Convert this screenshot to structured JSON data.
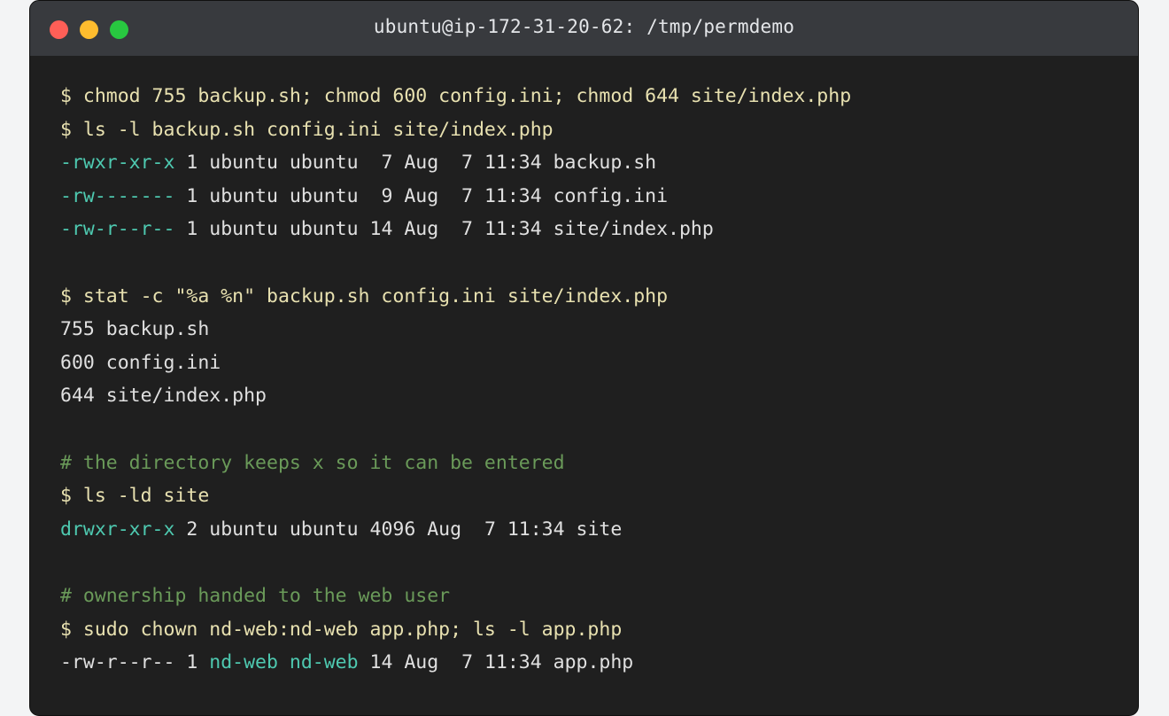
{
  "window": {
    "title": "ubuntu@ip-172-31-20-62: /tmp/permdemo"
  },
  "colors": {
    "command": "#e8e1b0",
    "comment": "#6a9a59",
    "permission": "#4ec9b0",
    "output": "#e0e0e0",
    "background": "#1f1f1f",
    "titlebar": "#383a3e"
  },
  "lines": [
    {
      "segments": [
        {
          "text": "$ chmod 755 backup.sh; chmod 600 config.ini; chmod 644 site/index.php",
          "kind": "cmd"
        }
      ]
    },
    {
      "segments": [
        {
          "text": "$ ls -l backup.sh config.ini site/index.php",
          "kind": "cmd"
        }
      ]
    },
    {
      "segments": [
        {
          "text": "-rwxr-xr-x",
          "kind": "perm"
        },
        {
          "text": " 1 ubuntu ubuntu  7 Aug  7 11:34 backup.sh",
          "kind": "plain"
        }
      ]
    },
    {
      "segments": [
        {
          "text": "-rw-------",
          "kind": "perm"
        },
        {
          "text": " 1 ubuntu ubuntu  9 Aug  7 11:34 config.ini",
          "kind": "plain"
        }
      ]
    },
    {
      "segments": [
        {
          "text": "-rw-r--r--",
          "kind": "perm"
        },
        {
          "text": " 1 ubuntu ubuntu 14 Aug  7 11:34 site/index.php",
          "kind": "plain"
        }
      ]
    },
    {
      "segments": []
    },
    {
      "segments": [
        {
          "text": "$ stat -c \"%a %n\" backup.sh config.ini site/index.php",
          "kind": "cmd"
        }
      ]
    },
    {
      "segments": [
        {
          "text": "755 backup.sh",
          "kind": "plain"
        }
      ]
    },
    {
      "segments": [
        {
          "text": "600 config.ini",
          "kind": "plain"
        }
      ]
    },
    {
      "segments": [
        {
          "text": "644 site/index.php",
          "kind": "plain"
        }
      ]
    },
    {
      "segments": []
    },
    {
      "segments": [
        {
          "text": "# the directory keeps x so it can be entered",
          "kind": "comment"
        }
      ]
    },
    {
      "segments": [
        {
          "text": "$ ls -ld site",
          "kind": "cmd"
        }
      ]
    },
    {
      "segments": [
        {
          "text": "drwxr-xr-x",
          "kind": "perm"
        },
        {
          "text": " 2 ubuntu ubuntu 4096 Aug  7 11:34 site",
          "kind": "plain"
        }
      ]
    },
    {
      "segments": []
    },
    {
      "segments": [
        {
          "text": "# ownership handed to the web user",
          "kind": "comment"
        }
      ]
    },
    {
      "segments": [
        {
          "text": "$ sudo chown nd-web:nd-web app.php; ls -l app.php",
          "kind": "cmd"
        }
      ]
    },
    {
      "segments": [
        {
          "text": "-rw-r--r-- 1 ",
          "kind": "plain"
        },
        {
          "text": "nd-web",
          "kind": "perm"
        },
        {
          "text": " ",
          "kind": "plain"
        },
        {
          "text": "nd-web",
          "kind": "perm"
        },
        {
          "text": " 14 Aug  7 11:34 app.php",
          "kind": "plain"
        }
      ]
    }
  ]
}
